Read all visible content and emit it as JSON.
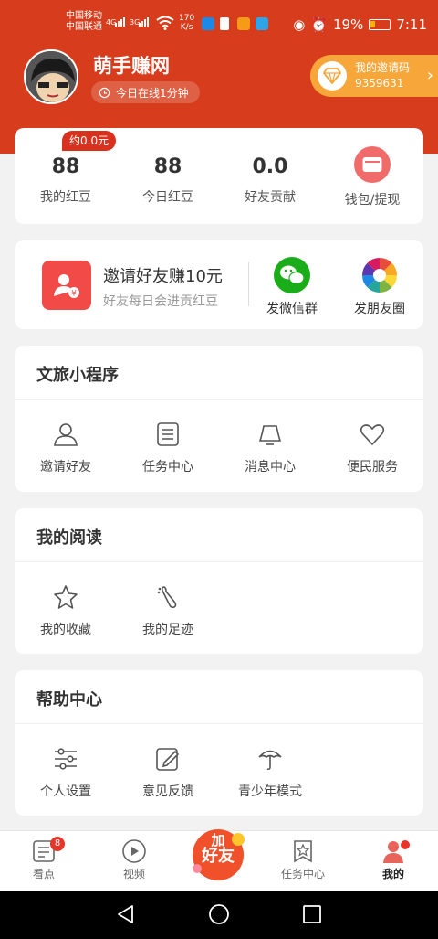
{
  "status_bar": {
    "carrier1": "中国移动",
    "carrier2": "中国联通",
    "net1": "4G",
    "net2": "3G",
    "speed_value": "170",
    "speed_unit": "K/s",
    "battery": "19%",
    "time": "7:11"
  },
  "profile": {
    "username": "萌手赚网",
    "online": "今日在线1分钟",
    "invite_label": "我的邀请码",
    "invite_code": "9359631"
  },
  "stats": {
    "estimate_badge": "约0.0元",
    "items": [
      {
        "value": "88",
        "label": "我的红豆"
      },
      {
        "value": "88",
        "label": "今日红豆"
      },
      {
        "value": "0.0",
        "label": "好友贡献"
      }
    ],
    "wallet_label": "钱包/提现"
  },
  "invite_card": {
    "title": "邀请好友赚10元",
    "subtitle": "好友每日会进贡红豆",
    "wechat_group": "发微信群",
    "moments": "发朋友圈"
  },
  "mini_programs": {
    "title": "文旅小程序",
    "items": [
      "邀请好友",
      "任务中心",
      "消息中心",
      "便民服务"
    ]
  },
  "reading": {
    "title": "我的阅读",
    "items": [
      "我的收藏",
      "我的足迹"
    ]
  },
  "help": {
    "title": "帮助中心",
    "items": [
      "个人设置",
      "意见反馈",
      "青少年模式"
    ]
  },
  "tabbar": {
    "items": [
      "看点",
      "视频",
      "任务中心",
      "我的"
    ],
    "badge_count": "8",
    "center_line1": "加",
    "center_line2": "好友"
  },
  "colors": {
    "brand_red": "#d73d1d",
    "invite_orange": "#f7a73a",
    "badge_red": "#e8352a"
  }
}
